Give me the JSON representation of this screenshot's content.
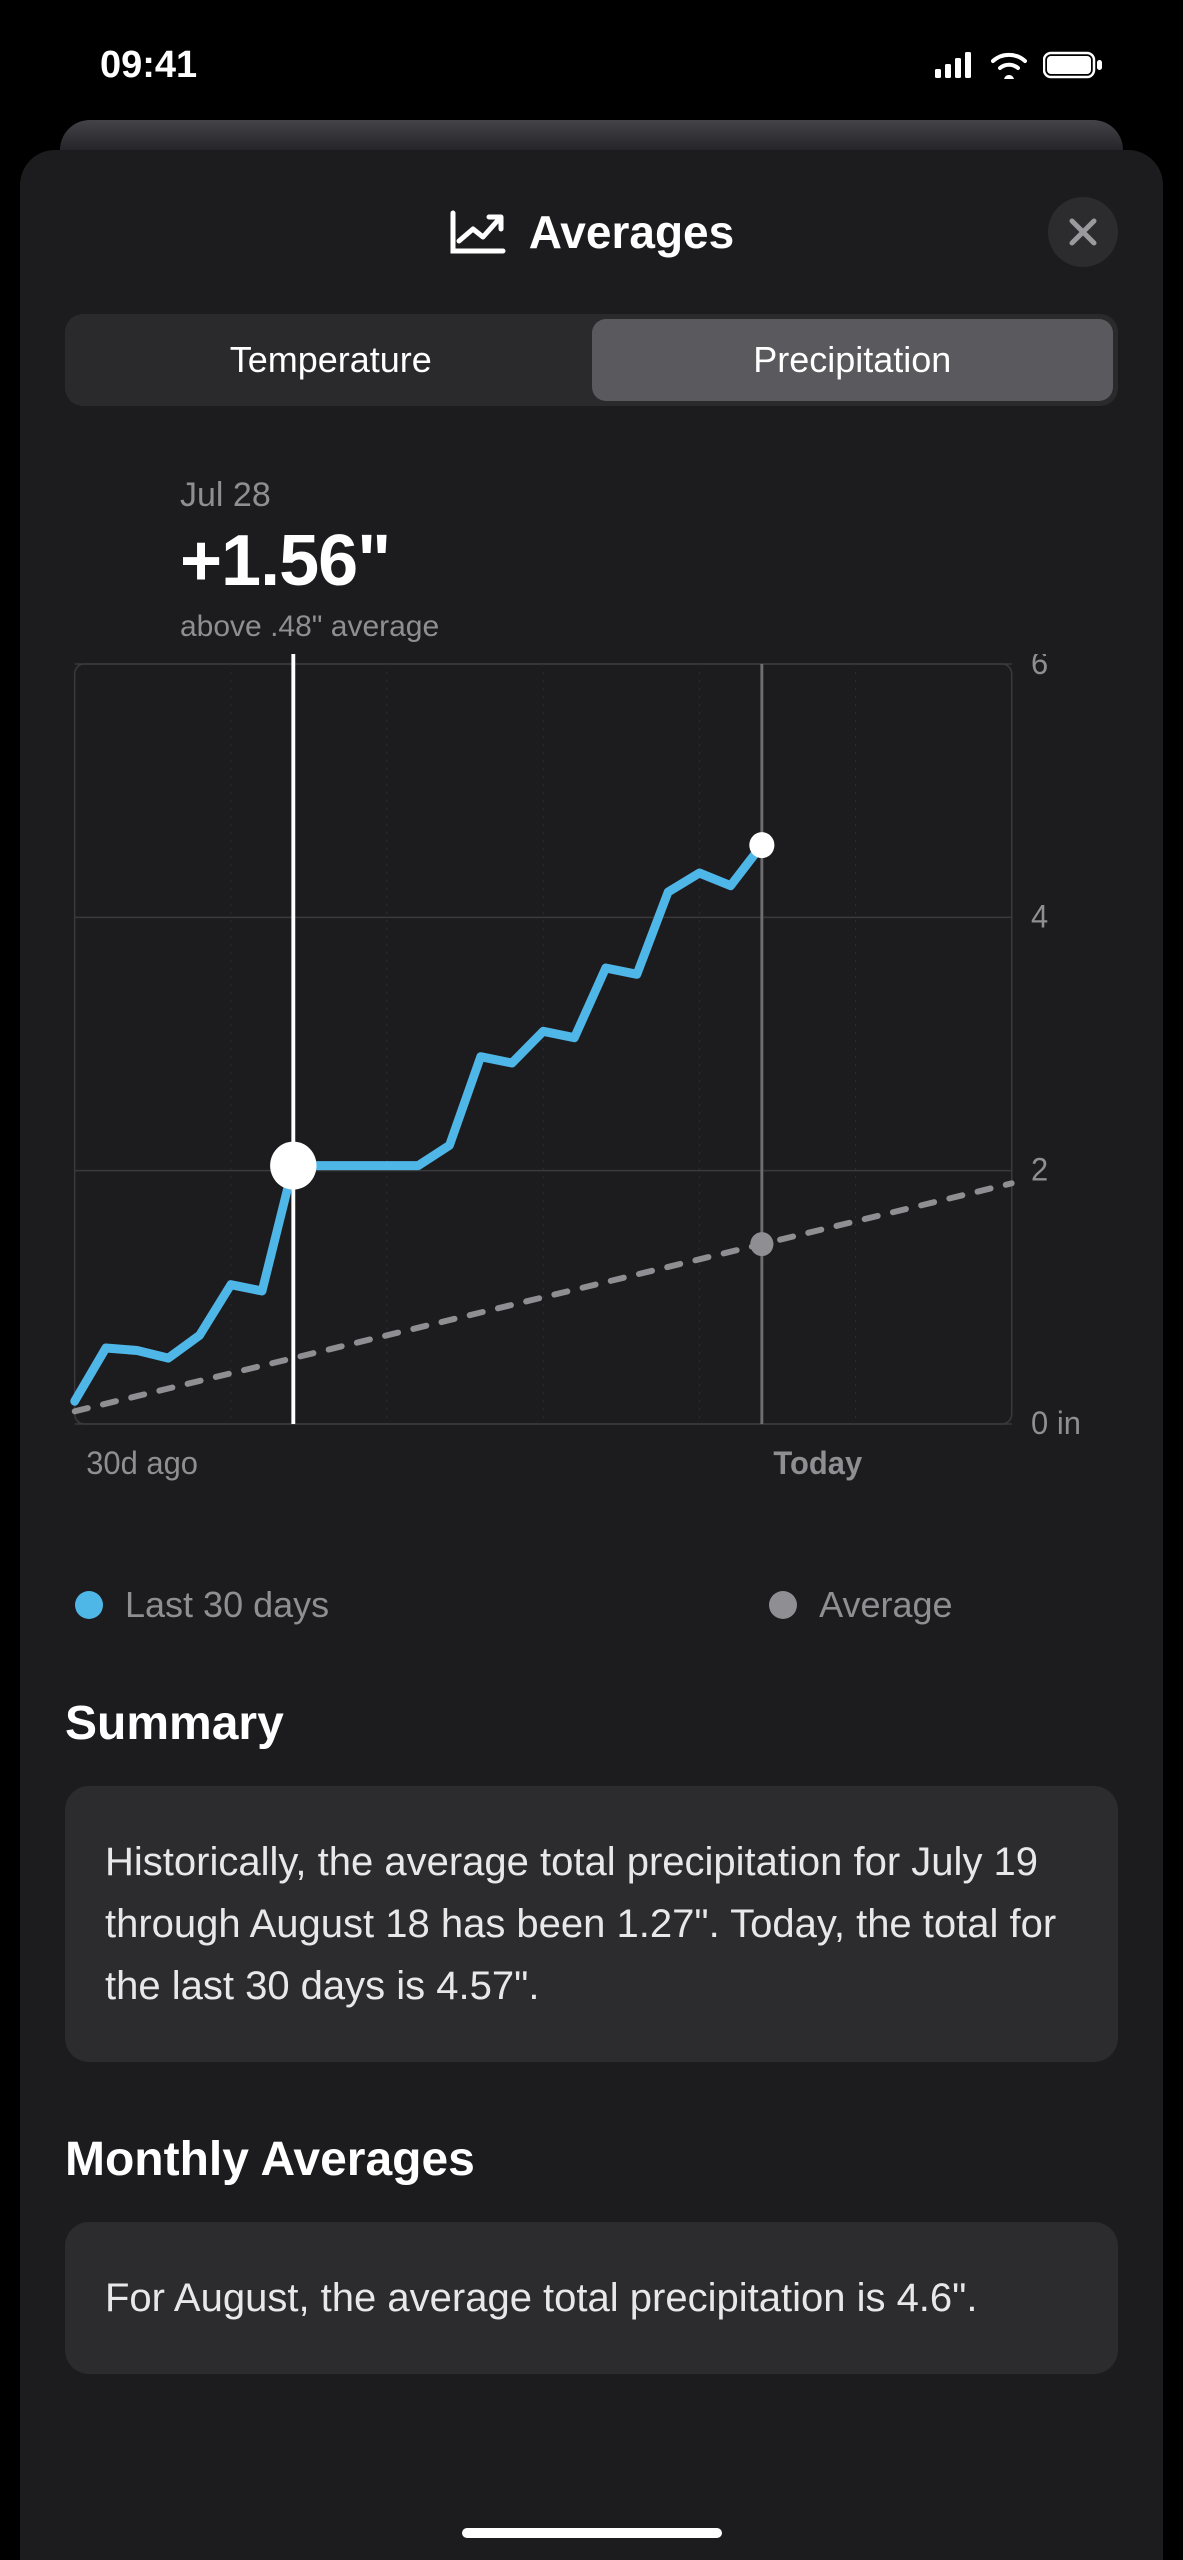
{
  "status": {
    "time": "09:41"
  },
  "header": {
    "title": "Averages"
  },
  "segments": {
    "temp": "Temperature",
    "precip": "Precipitation"
  },
  "chart_header": {
    "date": "Jul 28",
    "value": "+1.56\"",
    "sub": "above .48\" average"
  },
  "legend": {
    "last30": "Last 30 days",
    "avg": "Average"
  },
  "sections": {
    "summary_title": "Summary",
    "summary_text": "Historically, the average total precipitation for July 19 through August 18 has been 1.27\". Today, the total for the last 30 days is 4.57\".",
    "monthly_title": "Monthly Averages",
    "monthly_text": "For August, the average total precipitation is 4.6\"."
  },
  "chart_data": {
    "type": "line",
    "title": "Precipitation last 30 days vs average",
    "xlabel": "",
    "ylabel": "in",
    "ylim": [
      0,
      6
    ],
    "yticks": [
      0,
      2,
      4,
      6
    ],
    "x": [
      0,
      1,
      2,
      3,
      4,
      5,
      6,
      7,
      8,
      9,
      10,
      11,
      12,
      13,
      14,
      15,
      16,
      17,
      18,
      19,
      20,
      21,
      22,
      23,
      24,
      25,
      26,
      27,
      28,
      29,
      30
    ],
    "x_labels": {
      "0": "30d ago",
      "22": "Today"
    },
    "cursor_x": 7,
    "cursor_value": 2.04,
    "today_x": 22,
    "series": [
      {
        "name": "Last 30 days",
        "color": "#4fb6e8",
        "values": [
          0.18,
          0.6,
          0.58,
          0.52,
          0.7,
          1.1,
          1.05,
          2.04,
          2.04,
          2.04,
          2.04,
          2.04,
          2.2,
          2.9,
          2.85,
          3.1,
          3.05,
          3.6,
          3.55,
          4.2,
          4.35,
          4.25,
          4.57,
          null,
          null,
          null,
          null,
          null,
          null,
          null,
          null
        ]
      },
      {
        "name": "Average",
        "color": "#8e8e93",
        "dashed": true,
        "values": [
          0.1,
          0.16,
          0.22,
          0.28,
          0.34,
          0.4,
          0.46,
          0.52,
          0.58,
          0.64,
          0.7,
          0.76,
          0.82,
          0.88,
          0.94,
          1.0,
          1.06,
          1.12,
          1.18,
          1.24,
          1.3,
          1.36,
          1.42,
          1.48,
          1.54,
          1.6,
          1.66,
          1.72,
          1.78,
          1.84,
          1.9
        ]
      }
    ]
  }
}
